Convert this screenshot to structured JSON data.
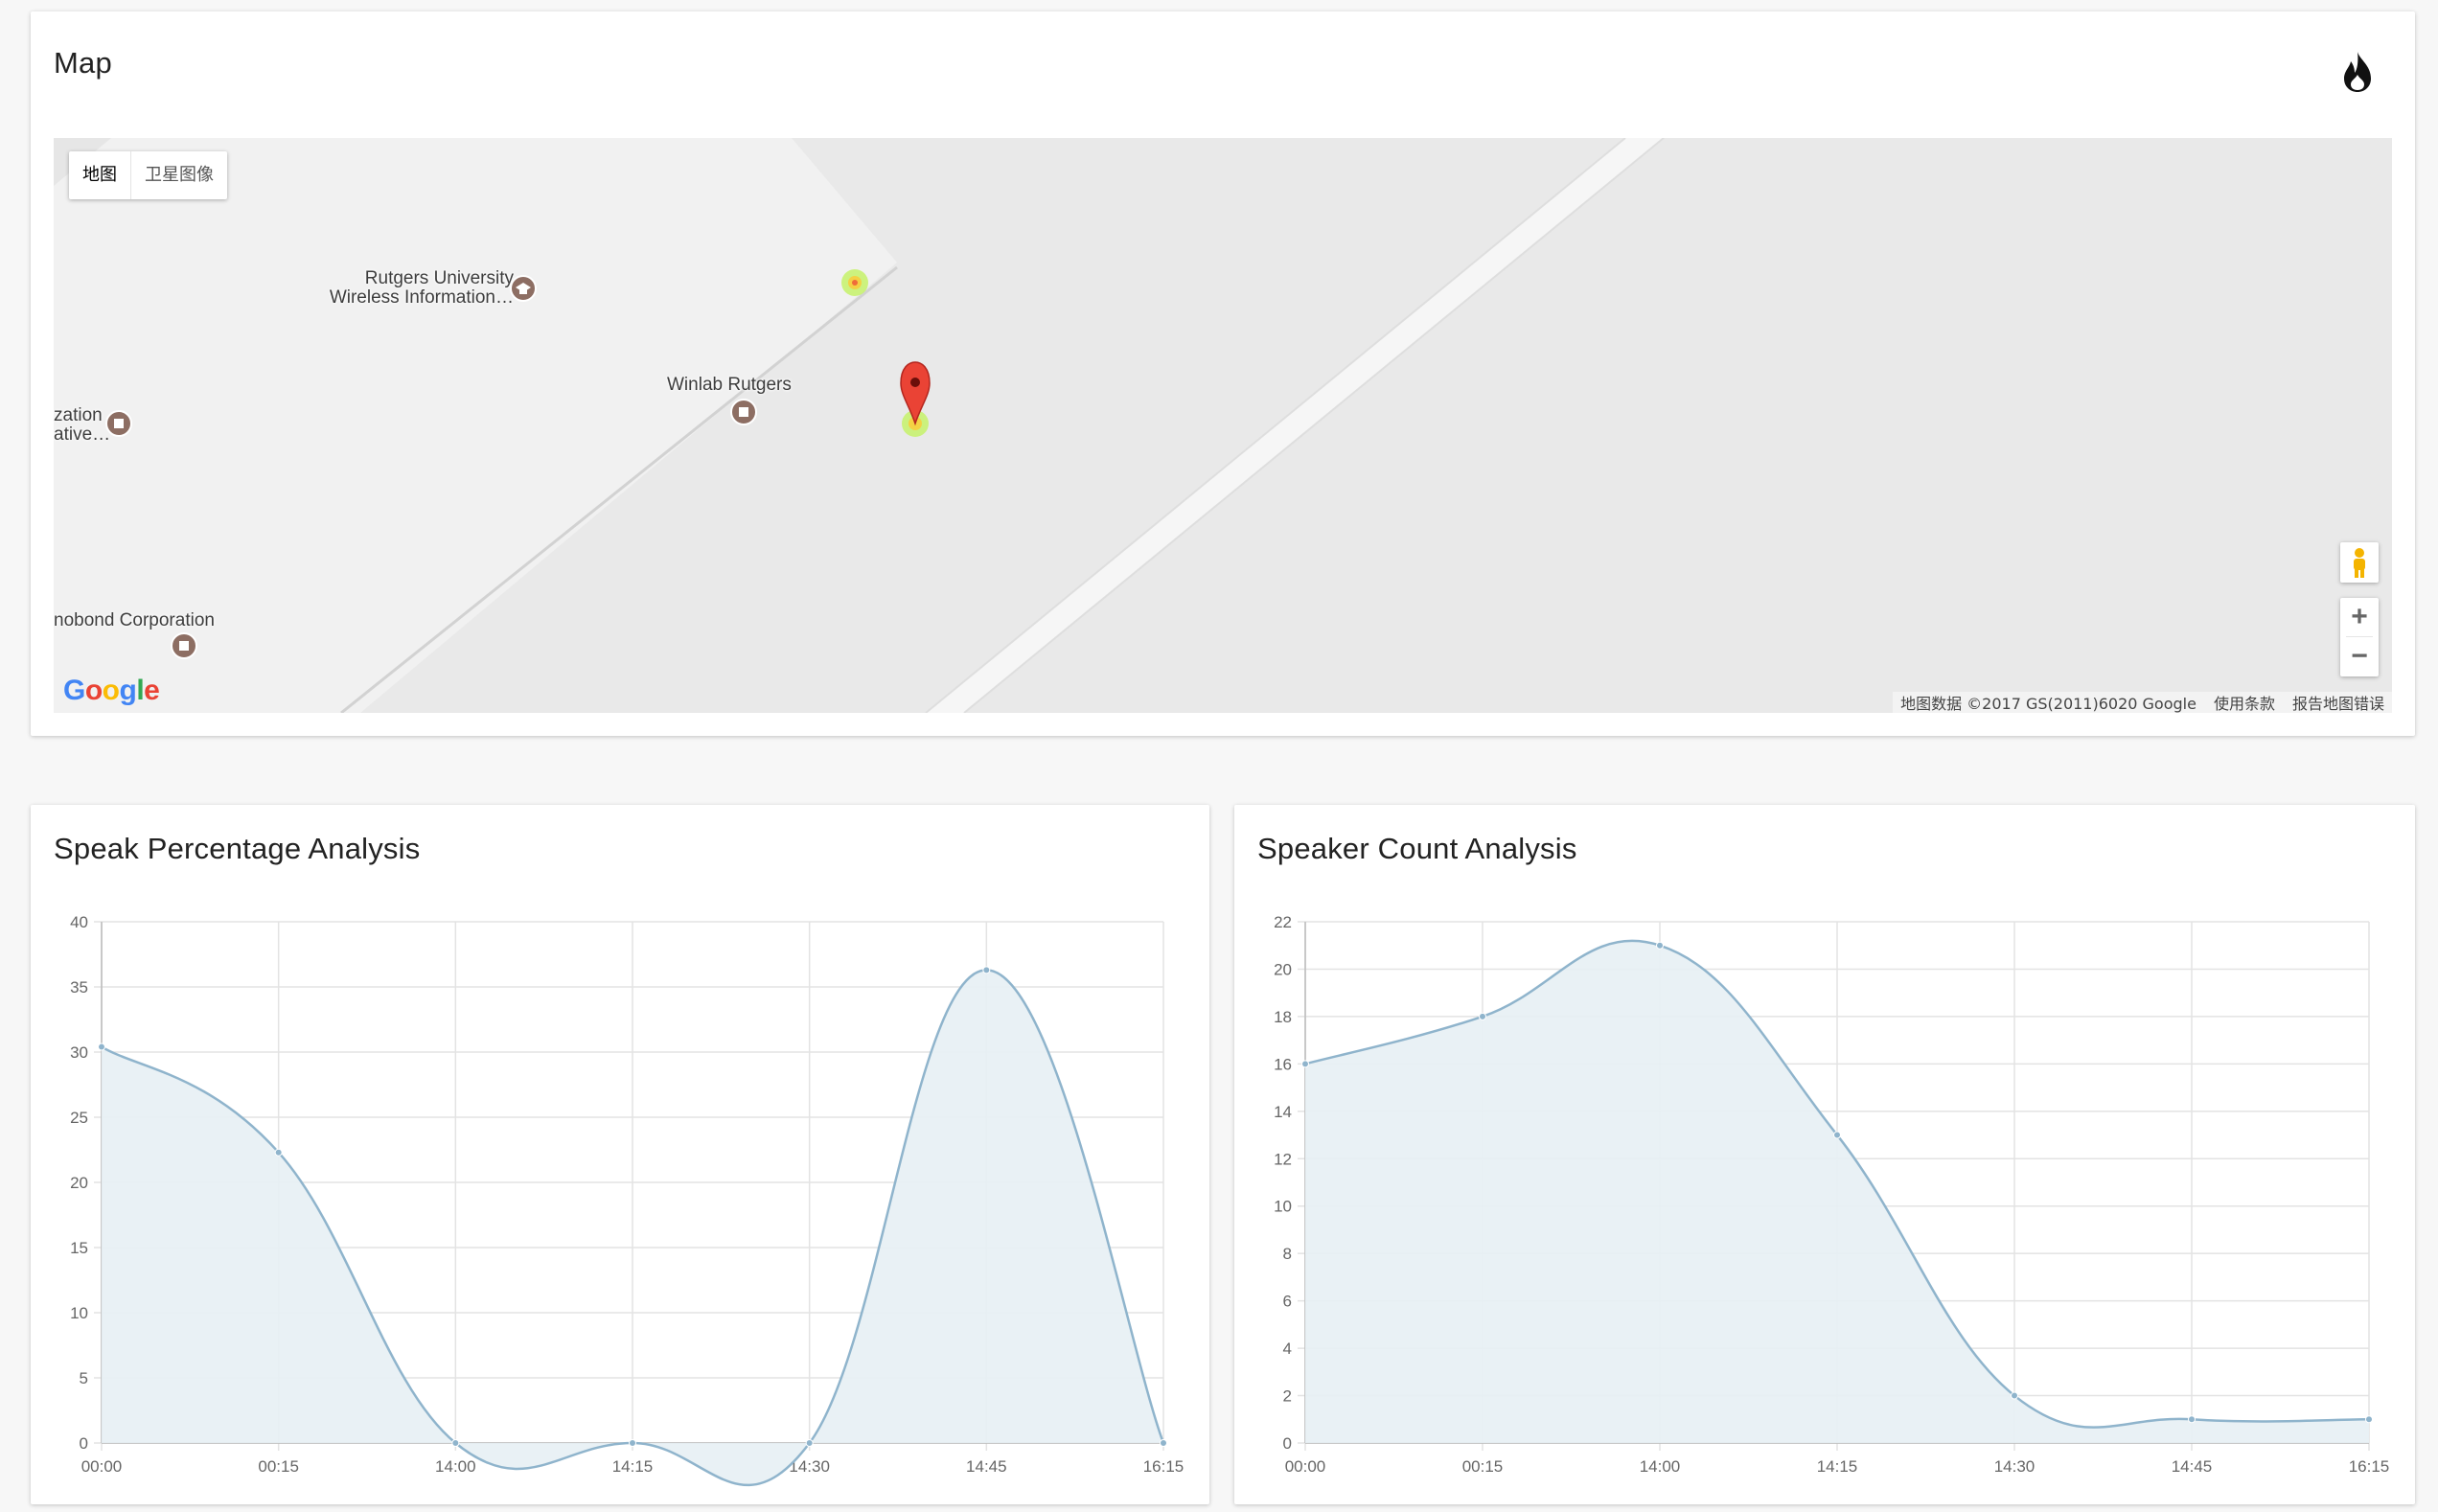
{
  "map_card": {
    "title": "Map",
    "map_type_buttons": [
      "地图",
      "卫星图像"
    ],
    "pois": [
      {
        "line1": "Rutgers University",
        "line2": "Wireless Information…"
      },
      {
        "line1": "Winlab Rutgers",
        "line2": ""
      },
      {
        "line1": "zation",
        "line2": "ative…"
      },
      {
        "line1": "nobond Corporation",
        "line2": ""
      }
    ],
    "footer": [
      "地图数据 ©2017 GS(2011)6020 Google",
      "使用条款",
      "报告地图错误"
    ],
    "logo_text": "Google",
    "zoom_in": "+",
    "zoom_out": "−"
  },
  "charts": [
    {
      "title": "Speak Percentage Analysis",
      "chart_data": {
        "type": "area",
        "x": [
          "00:00",
          "00:15",
          "14:00",
          "14:15",
          "14:30",
          "14:45",
          "16:15"
        ],
        "values": [
          30.4,
          22.3,
          0,
          0,
          0,
          36.3,
          0
        ],
        "ylim": [
          0,
          40
        ],
        "yticks": [
          0,
          5,
          10,
          15,
          20,
          25,
          30,
          35,
          40
        ],
        "grid": true,
        "color": "#8fb4cc"
      }
    },
    {
      "title": "Speaker Count Analysis",
      "chart_data": {
        "type": "area",
        "x": [
          "00:00",
          "00:15",
          "14:00",
          "14:15",
          "14:30",
          "14:45",
          "16:15"
        ],
        "values": [
          16,
          18,
          21,
          13,
          2,
          1,
          1
        ],
        "ylim": [
          0,
          22
        ],
        "yticks": [
          0,
          2,
          4,
          6,
          8,
          10,
          12,
          14,
          16,
          18,
          20,
          22
        ],
        "grid": true,
        "color": "#8fb4cc"
      }
    }
  ],
  "colors": {
    "line": "#8fb4cc",
    "fill": "#e7eff4",
    "marker": "#e94235",
    "accent_google": [
      "#4285F4",
      "#EA4335",
      "#FBBC05",
      "#34A853"
    ]
  }
}
